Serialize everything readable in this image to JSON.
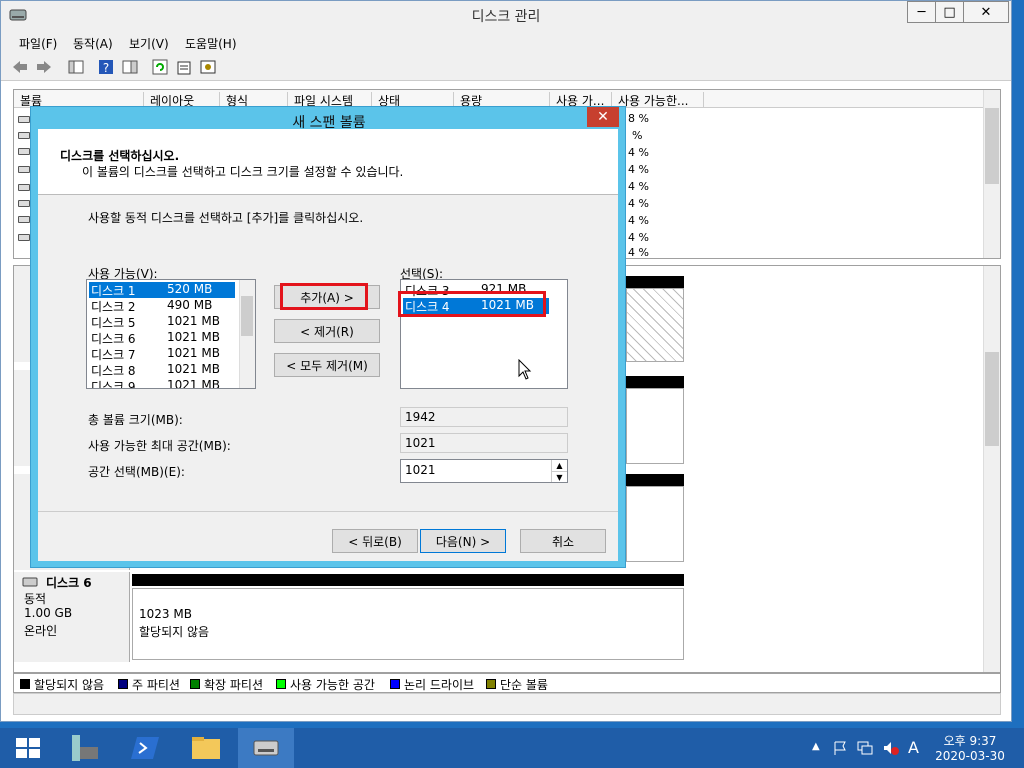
{
  "window": {
    "title": "디스크 관리"
  },
  "menu": [
    "파일(F)",
    "동작(A)",
    "보기(V)",
    "도움말(H)"
  ],
  "list": {
    "columns": [
      "볼륨",
      "레이아웃",
      "형식",
      "파일 시스템",
      "상태",
      "용량",
      "사용 가...",
      "사용 가능한..."
    ],
    "percent_values": [
      "8 %",
      "%",
      "4 %",
      "4 %",
      "4 %",
      "4 %",
      "4 %",
      "4 %",
      "4 %"
    ]
  },
  "graph": {
    "disk6": {
      "name": "디스크 6",
      "type": "동적",
      "size": "1.00 GB",
      "status": "온라인",
      "part_size": "1023 MB",
      "part_status": "할당되지 않음"
    }
  },
  "legend": [
    {
      "label": "할당되지 않음",
      "color": "#000000"
    },
    {
      "label": "주 파티션",
      "color": "#000080"
    },
    {
      "label": "확장 파티션",
      "color": "#008000"
    },
    {
      "label": "사용 가능한 공간",
      "color": "#00ff00"
    },
    {
      "label": "논리 드라이브",
      "color": "#0000ff"
    },
    {
      "label": "단순 볼륨",
      "color": "#808000"
    }
  ],
  "dialog": {
    "title": "새 스팬 볼륨",
    "header_title": "디스크를 선택하십시오.",
    "header_desc": "이 볼륨의 디스크를 선택하고 디스크 크기를 설정할 수 있습니다.",
    "instruction": "사용할 동적 디스크를 선택하고 [추가]를 클릭하십시오.",
    "available_label": "사용 가능(V):",
    "selected_label": "선택(S):",
    "available": [
      {
        "disk": "디스크 1",
        "size": "520 MB",
        "selected": true
      },
      {
        "disk": "디스크 2",
        "size": "490 MB"
      },
      {
        "disk": "디스크 5",
        "size": "1021 MB"
      },
      {
        "disk": "디스크 6",
        "size": "1021 MB"
      },
      {
        "disk": "디스크 7",
        "size": "1021 MB"
      },
      {
        "disk": "디스크 8",
        "size": "1021 MB"
      },
      {
        "disk": "디스크 9",
        "size": "1021 MB"
      }
    ],
    "selected": [
      {
        "disk": "디스크 3",
        "size": "921 MB"
      },
      {
        "disk": "디스크 4",
        "size": "1021 MB",
        "selected": true
      }
    ],
    "add_button": "추가(A) >",
    "remove_button": "< 제거(R)",
    "remove_all_button": "< 모두 제거(M)",
    "total_size_label": "총 볼륨 크기(MB):",
    "total_size_value": "1942",
    "max_space_label": "사용 가능한 최대 공간(MB):",
    "max_space_value": "1021",
    "select_space_label": "공간 선택(MB)(E):",
    "select_space_value": "1021",
    "back_button": "< 뒤로(B)",
    "next_button": "다음(N) >",
    "cancel_button": "취소"
  },
  "taskbar": {
    "time": "오후 9:37",
    "date": "2020-03-30"
  },
  "colors": {
    "dialog_frame": "#5bc4ea",
    "selection": "#0078d7",
    "highlight": "#e3131b",
    "taskbar": "#1f5da8"
  }
}
